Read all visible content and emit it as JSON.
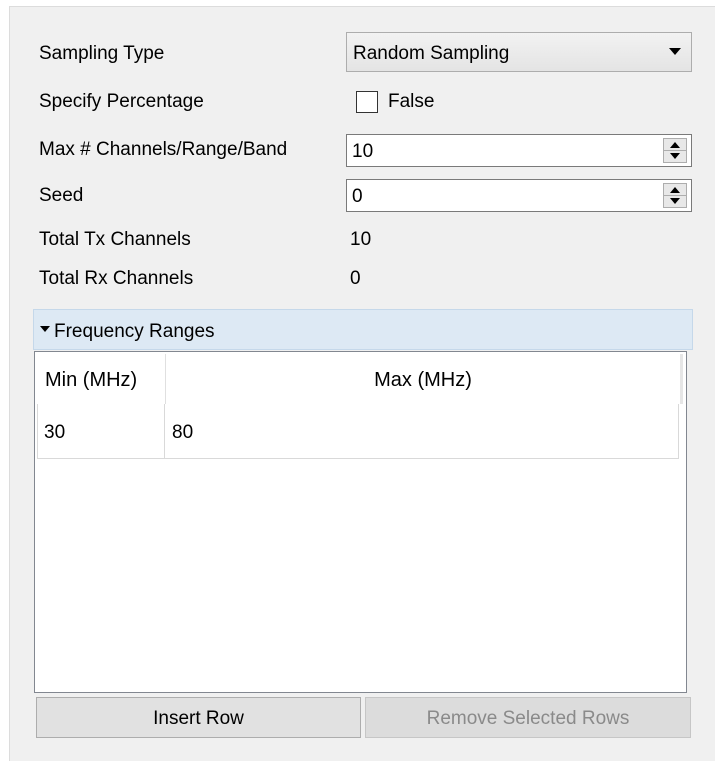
{
  "form": {
    "sampling_type": {
      "label": "Sampling Type",
      "value": "Random Sampling"
    },
    "specify_percentage": {
      "label": "Specify Percentage",
      "checked": false,
      "value_label": "False"
    },
    "max_channels": {
      "label": "Max # Channels/Range/Band",
      "value": "10"
    },
    "seed": {
      "label": "Seed",
      "value": "0"
    },
    "total_tx": {
      "label": "Total Tx Channels",
      "value": "10"
    },
    "total_rx": {
      "label": "Total Rx Channels",
      "value": "0"
    }
  },
  "section": {
    "title": "Frequency Ranges",
    "expanded": true
  },
  "table": {
    "columns": [
      "Min (MHz)",
      "Max (MHz)"
    ],
    "rows": [
      [
        "30",
        "80"
      ]
    ]
  },
  "buttons": {
    "insert_row": "Insert Row",
    "remove_selected": "Remove Selected Rows"
  },
  "colors": {
    "panel_bg": "#f0f0f0",
    "section_bg": "#dde9f4",
    "disabled_text": "#8a8a8a"
  }
}
